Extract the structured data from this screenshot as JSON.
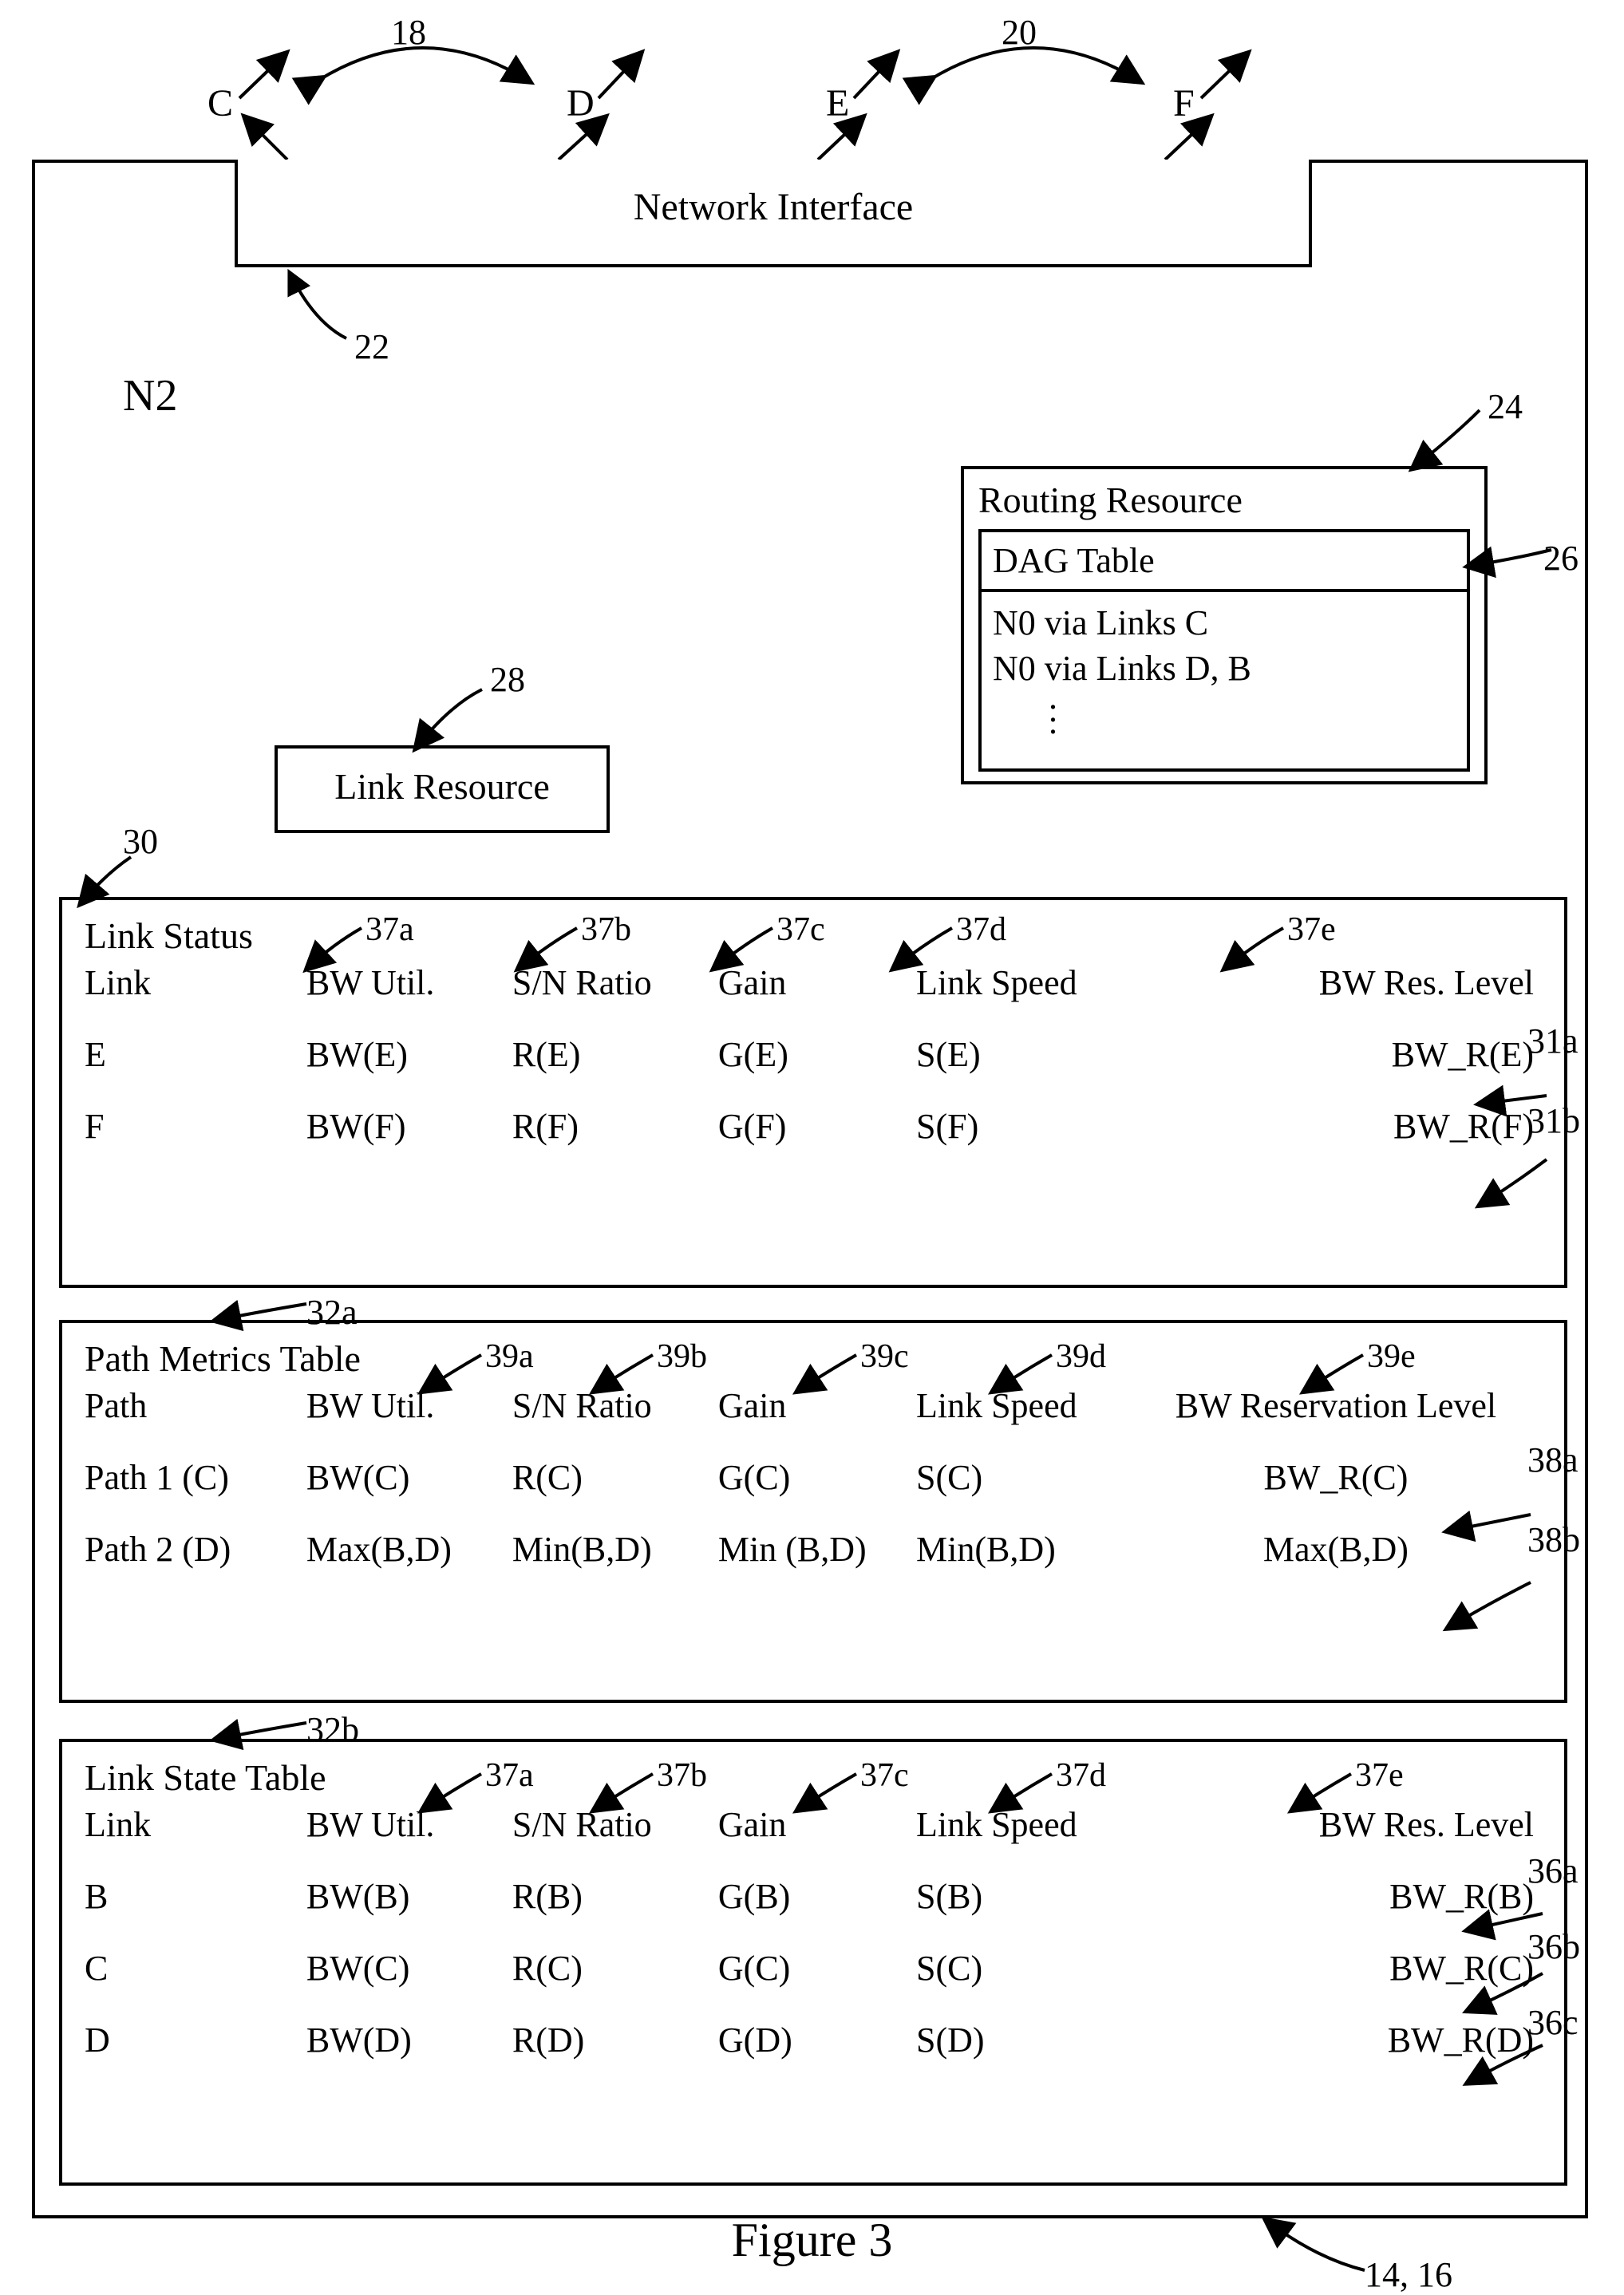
{
  "figure_caption": "Figure 3",
  "node_label": "N2",
  "network_interface_label": "Network Interface",
  "link_resource_label": "Link Resource",
  "routing_resource": {
    "title": "Routing Resource",
    "dag_table_title": "DAG Table",
    "dag_rows": [
      "N0 via Links C",
      "N0 via Links D, B"
    ]
  },
  "top_ports": {
    "C": "C",
    "D": "D",
    "E": "E",
    "F": "F"
  },
  "ref": {
    "r18": "18",
    "r20": "20",
    "r22": "22",
    "r24": "24",
    "r26": "26",
    "r28": "28",
    "r30": "30",
    "r37a": "37a",
    "r37b": "37b",
    "r37c": "37c",
    "r37d": "37d",
    "r37e": "37e",
    "r31a": "31a",
    "r31b": "31b",
    "r32a": "32a",
    "r32b": "32b",
    "r39a": "39a",
    "r39b": "39b",
    "r39c": "39c",
    "r39d": "39d",
    "r39e": "39e",
    "r38a": "38a",
    "r38b": "38b",
    "r36a": "36a",
    "r36b": "36b",
    "r36c": "36c",
    "r14_16": "14, 16"
  },
  "link_status": {
    "title": "Link Status",
    "headers": {
      "link": "Link",
      "bw": "BW Util.",
      "sn": "S/N Ratio",
      "gain": "Gain",
      "speed": "Link Speed",
      "res": "BW Res. Level"
    },
    "rows": [
      {
        "link": "E",
        "bw": "BW(E)",
        "sn": "R(E)",
        "gain": "G(E)",
        "speed": "S(E)",
        "res": "BW_R(E)"
      },
      {
        "link": "F",
        "bw": "BW(F)",
        "sn": "R(F)",
        "gain": "G(F)",
        "speed": "S(F)",
        "res": "BW_R(F)"
      }
    ]
  },
  "path_metrics": {
    "title": "Path Metrics Table",
    "headers": {
      "path": "Path",
      "bw": "BW Util.",
      "sn": "S/N Ratio",
      "gain": "Gain",
      "speed": "Link Speed",
      "res": "BW Reservation Level"
    },
    "rows": [
      {
        "path": "Path 1 (C)",
        "bw": "BW(C)",
        "sn": "R(C)",
        "gain": "G(C)",
        "speed": "S(C)",
        "res": "BW_R(C)"
      },
      {
        "path": "Path 2 (D)",
        "bw": "Max(B,D)",
        "sn": "Min(B,D)",
        "gain": "Min (B,D)",
        "speed": "Min(B,D)",
        "res": "Max(B,D)"
      }
    ]
  },
  "link_state": {
    "title": "Link State Table",
    "headers": {
      "link": "Link",
      "bw": "BW Util.",
      "sn": "S/N Ratio",
      "gain": "Gain",
      "speed": "Link Speed",
      "res": "BW Res. Level"
    },
    "rows": [
      {
        "link": "B",
        "bw": "BW(B)",
        "sn": "R(B)",
        "gain": "G(B)",
        "speed": "S(B)",
        "res": "BW_R(B)"
      },
      {
        "link": "C",
        "bw": "BW(C)",
        "sn": "R(C)",
        "gain": "G(C)",
        "speed": "S(C)",
        "res": "BW_R(C)"
      },
      {
        "link": "D",
        "bw": "BW(D)",
        "sn": "R(D)",
        "gain": "G(D)",
        "speed": "S(D)",
        "res": "BW_R(D)"
      }
    ]
  }
}
